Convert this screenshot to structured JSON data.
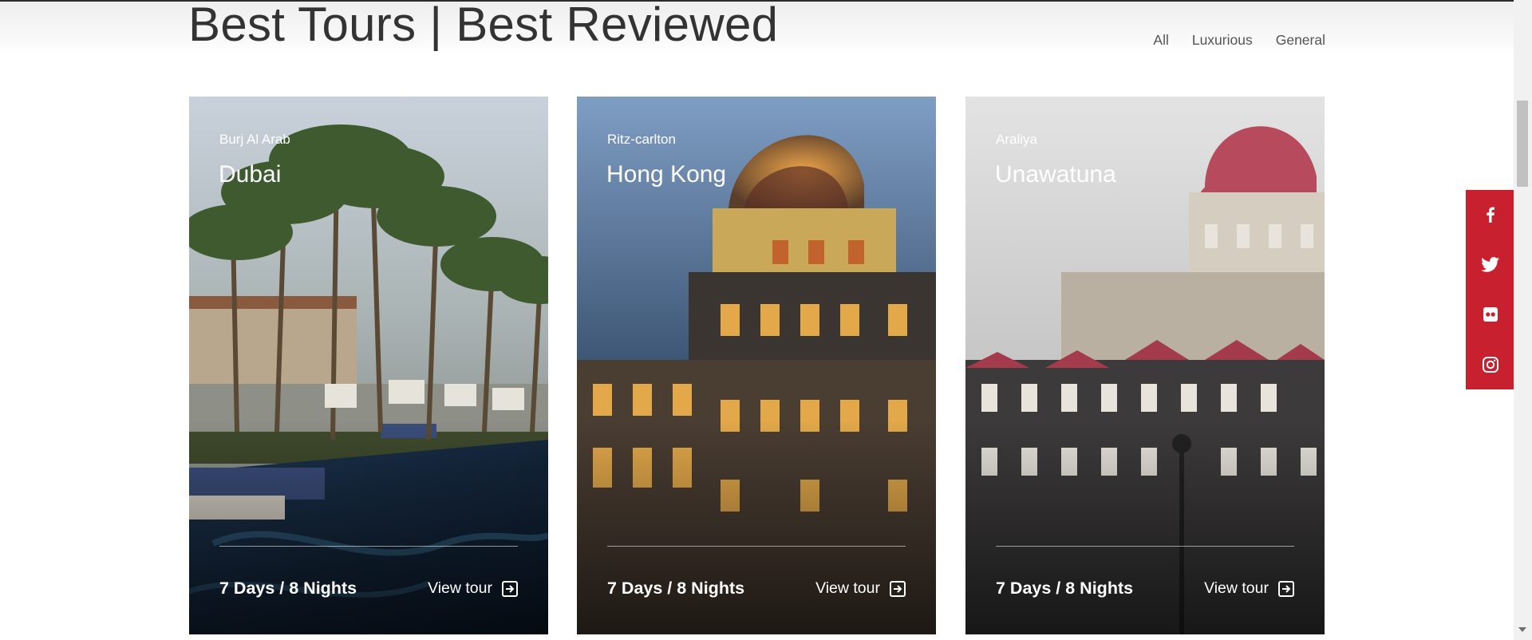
{
  "section": {
    "title": "Best Tours | Best Reviewed",
    "filters": [
      "All",
      "Luxurious",
      "General"
    ]
  },
  "cards": [
    {
      "subtitle": "Burj Al Arab",
      "title": "Dubai",
      "duration": "7 Days / 8 Nights",
      "link_label": "View tour",
      "link_icon": "arrow-right-box-icon"
    },
    {
      "subtitle": "Ritz-carlton",
      "title": "Hong Kong",
      "duration": "7 Days / 8 Nights",
      "link_label": "View tour",
      "link_icon": "arrow-right-box-icon"
    },
    {
      "subtitle": "Araliya",
      "title": "Unawatuna",
      "duration": "7 Days / 8 Nights",
      "link_label": "View tour",
      "link_icon": "arrow-right-box-icon"
    }
  ],
  "social_bar": {
    "background": "#c8202f",
    "icons": [
      "facebook-icon",
      "twitter-icon",
      "flickr-icon",
      "instagram-icon"
    ]
  }
}
